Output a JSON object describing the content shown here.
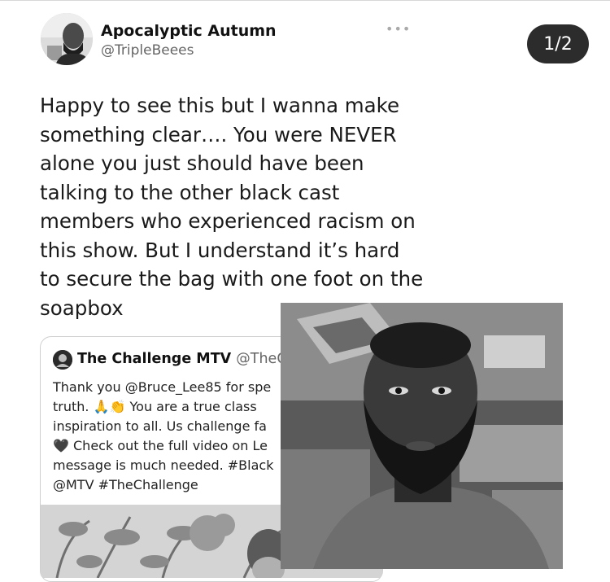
{
  "tweet": {
    "author_name": "Apocalyptic Autumn",
    "author_handle": "@TripleBeees",
    "more_label": "•••",
    "pager": "1/2",
    "text_lines": [
      "Happy to see this but I wanna make",
      "something clear…. You were NEVER",
      "alone you just should have been",
      "talking to the other black cast",
      "members who experienced racism on",
      "this show. But I understand it’s hard",
      "to secure the bag with one foot on the",
      "soapbox"
    ]
  },
  "quoted": {
    "name": "The Challenge MTV",
    "handle": "@TheCh",
    "text_lines": [
      "Thank you @Bruce_Lee85 for spe",
      "truth. 🙏👏 You are a true class",
      "inspiration to all. Us challenge fa",
      "🖤 Check out the full video on Le",
      "message is much needed. #Black",
      "@MTV #TheChallenge"
    ]
  },
  "colors": {
    "pager_bg": "#2c2c2c",
    "text": "#1a1a1a",
    "muted": "#666666"
  }
}
